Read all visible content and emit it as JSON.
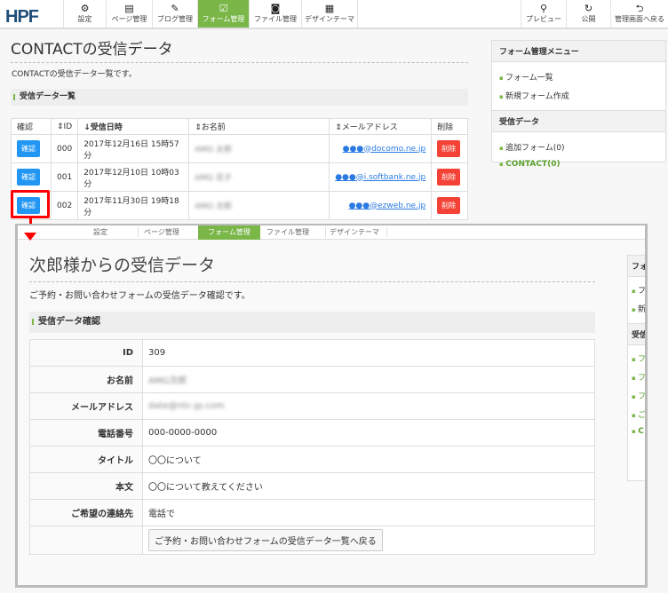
{
  "nav": {
    "logo": "HPF",
    "items": [
      {
        "icon": "gear-icon",
        "glyph": "⚙",
        "label": "設定"
      },
      {
        "icon": "page-icon",
        "glyph": "▤",
        "label": "ページ管理"
      },
      {
        "icon": "pen-icon",
        "glyph": "✎",
        "label": "ブログ管理"
      },
      {
        "icon": "form-icon",
        "glyph": "☑",
        "label": "フォーム管理",
        "active": true
      },
      {
        "icon": "camera-icon",
        "glyph": "◙",
        "label": "ファイル管理"
      },
      {
        "icon": "theme-icon",
        "glyph": "▦",
        "label": "デザインテーマ"
      }
    ],
    "right": [
      {
        "icon": "search-icon",
        "glyph": "⚲",
        "label": "プレビュー"
      },
      {
        "icon": "refresh-icon",
        "glyph": "↻",
        "label": "公開"
      },
      {
        "icon": "return-icon",
        "glyph": "⮌",
        "label": "管理画面へ戻る"
      }
    ]
  },
  "main": {
    "title": "CONTACTの受信データ",
    "desc": "CONTACTの受信データ一覧です。",
    "section": "受信データ一覧",
    "columns": [
      "確認",
      "⇕ID",
      "↓受信日時",
      "⇕お名前",
      "⇕メールアドレス",
      "削除"
    ],
    "rows": [
      {
        "confirm": "確認",
        "id": "000",
        "date": "2017年12月16日 15時57分",
        "name": "AMG 太郎",
        "email": "●●●@docomo.ne.jp",
        "delete": "削除"
      },
      {
        "confirm": "確認",
        "id": "001",
        "date": "2017年12月10日 10時03分",
        "name": "AMG 花子",
        "email": "●●●@i.softbank.ne.jp",
        "delete": "削除"
      },
      {
        "confirm": "確認",
        "id": "002",
        "date": "2017年11月30日 19時18分",
        "name": "AMG 次郎",
        "email": "●●●@ezweb.ne.jp",
        "delete": "削除"
      }
    ]
  },
  "sidebar": {
    "menu_title": "フォーム管理メニュー",
    "menu": [
      "フォーム一覧",
      "新規フォーム作成"
    ],
    "data_title": "受信データ",
    "data": [
      "追加フォーム(0)",
      "CONTACT(0)"
    ]
  },
  "detail": {
    "tabs": [
      "設定",
      "ページ管理",
      "フォーム管理",
      "ファイル管理",
      "デザインテーマ"
    ],
    "title": "次郎様からの受信データ",
    "desc": "ご予約・お問い合わせフォームの受信データ確認です。",
    "section": "受信データ確認",
    "fields": [
      {
        "label": "ID",
        "value": "309"
      },
      {
        "label": "お名前",
        "value": "AMG次郎"
      },
      {
        "label": "メールアドレス",
        "value": "date@ntc-jp.com"
      },
      {
        "label": "電話番号",
        "value": "000-0000-0000"
      },
      {
        "label": "タイトル",
        "value": "〇〇について"
      },
      {
        "label": "本文",
        "value": "〇〇について教えてください"
      },
      {
        "label": "ご希望の連絡先",
        "value": "電話で"
      }
    ],
    "back_button": "ご予約・お問い合わせフォームの受信データ一覧へ戻る",
    "side_partial": [
      "フォ",
      "フ",
      "新",
      "受信",
      "フ",
      "フ",
      "フ",
      "ご",
      "C"
    ]
  },
  "colors": {
    "accent": "#7ab648",
    "primary": "#2196f3",
    "danger": "#f44336",
    "highlight": "#ff0000"
  }
}
